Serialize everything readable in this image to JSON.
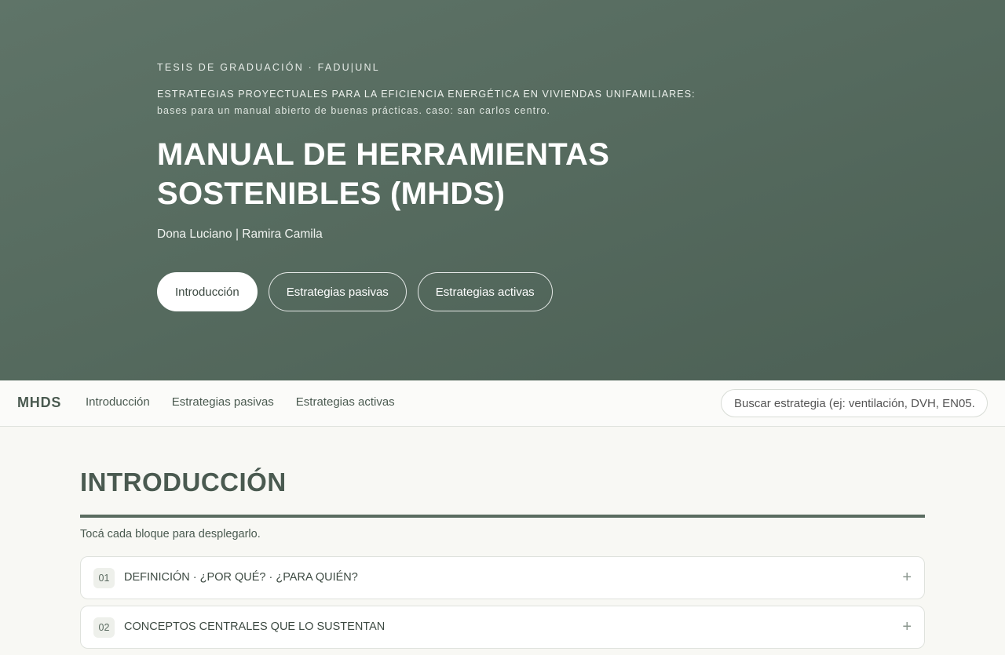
{
  "hero": {
    "kicker": "TESIS DE GRADUACIÓN · FADU|UNL",
    "subtitle_line1": "ESTRATEGIAS PROYECTUALES PARA LA EFICIENCIA ENERGÉTICA EN VIVIENDAS UNIFAMILIARES:",
    "subtitle_line2": "bases para un manual abierto de buenas prácticas. caso: san carlos centro.",
    "title": "MANUAL DE HERRAMIENTAS SOSTENIBLES (MHDS)",
    "authors": "Dona Luciano | Ramira Camila",
    "buttons": [
      {
        "label": "Introducción",
        "active": true
      },
      {
        "label": "Estrategias pasivas",
        "active": false
      },
      {
        "label": "Estrategias activas",
        "active": false
      }
    ]
  },
  "nav": {
    "brand": "MHDS",
    "links": [
      "Introducción",
      "Estrategias pasivas",
      "Estrategias activas"
    ],
    "search_placeholder": "Buscar estrategia (ej: ventilación, DVH, EN05..."
  },
  "main": {
    "section_title": "INTRODUCCIÓN",
    "hint": "Tocá cada bloque para desplegarlo.",
    "accordion": [
      {
        "num": "01",
        "label": "DEFINICIÓN · ¿POR QUÉ? · ¿PARA QUIÉN?",
        "icon": "plus-icon"
      },
      {
        "num": "02",
        "label": "CONCEPTOS CENTRALES QUE LO SUSTENTAN",
        "icon": "plus-icon"
      }
    ]
  },
  "colors": {
    "hero_bg": "#566b5f",
    "accent": "#4a5a50",
    "page_bg": "#f8f8f4"
  }
}
